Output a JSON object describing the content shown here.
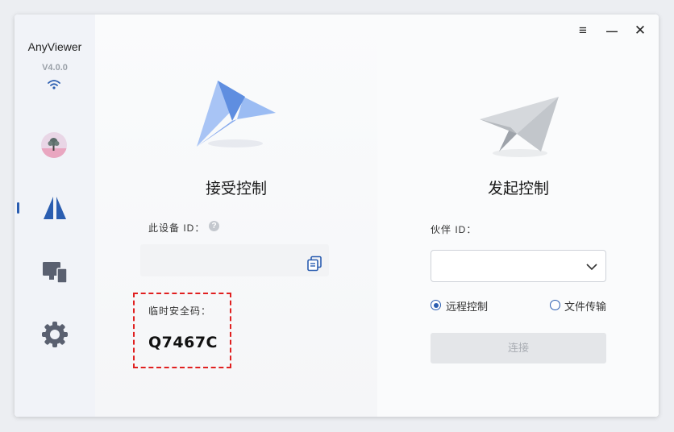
{
  "app": {
    "title": "AnyViewer",
    "version": "V4.0.0"
  },
  "window_controls": {
    "menu": "≡",
    "minimize": "—",
    "close": "✕"
  },
  "sidebar": {
    "items": [
      {
        "name": "avatar",
        "icon": "tree-avatar"
      },
      {
        "name": "remote-control",
        "icon": "anyviewer-logo-icon",
        "active": true
      },
      {
        "name": "devices",
        "icon": "monitor-devices-icon"
      },
      {
        "name": "settings",
        "icon": "gear-icon"
      }
    ]
  },
  "receive": {
    "title": "接受控制",
    "device_id_label": "此设备 ID：",
    "help": "?",
    "device_id_value": "",
    "temp_code_label": "临时安全码：",
    "temp_code": "Q7467C"
  },
  "initiate": {
    "title": "发起控制",
    "partner_id_label": "伙伴 ID：",
    "partner_id_value": "",
    "options": [
      {
        "label": "远程控制",
        "selected": true
      },
      {
        "label": "文件传输",
        "selected": false
      }
    ],
    "connect_label": "连接"
  },
  "colors": {
    "accent": "#2a5db0",
    "highlight": "#e02020"
  }
}
